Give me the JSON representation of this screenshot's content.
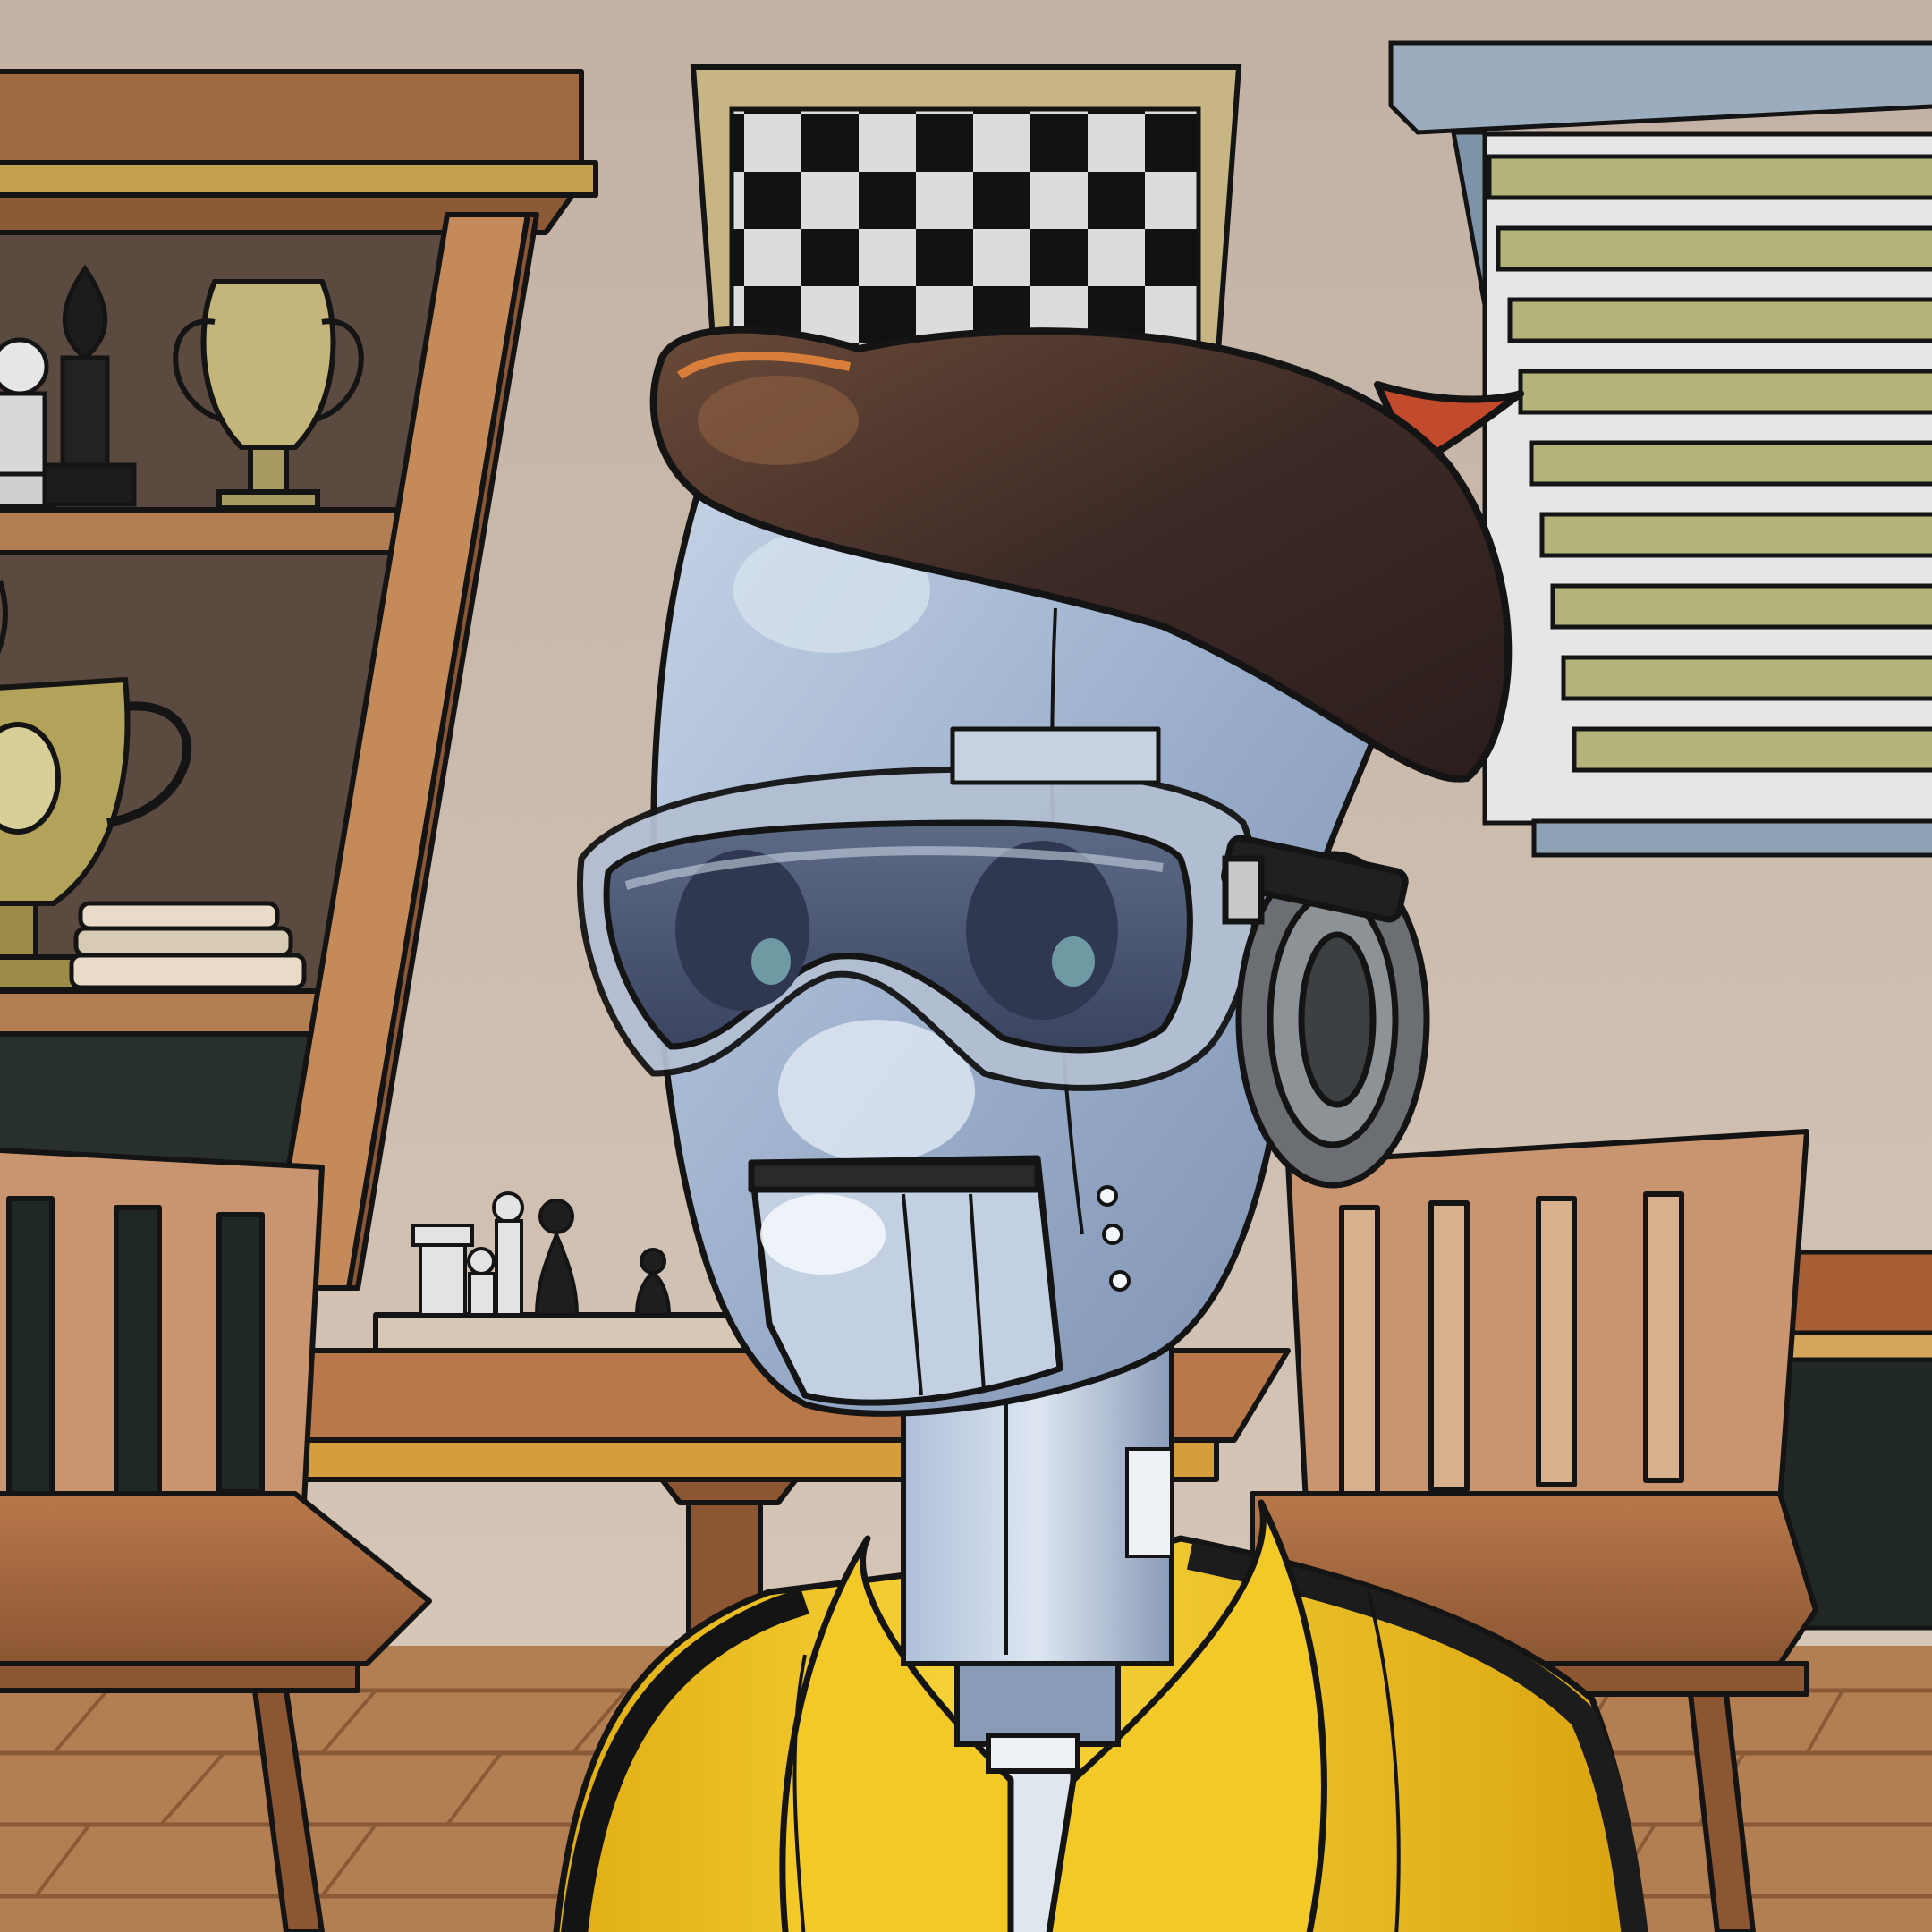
{
  "scene": {
    "subject": "robot",
    "colors": {
      "wall": "#c7b6a9",
      "floor": "#b27e52",
      "wood": "#a0673e",
      "metal": "#9fb2cf",
      "beret": "#3d2a26",
      "jacket": "#f1c21b",
      "outline": "#141414"
    }
  }
}
